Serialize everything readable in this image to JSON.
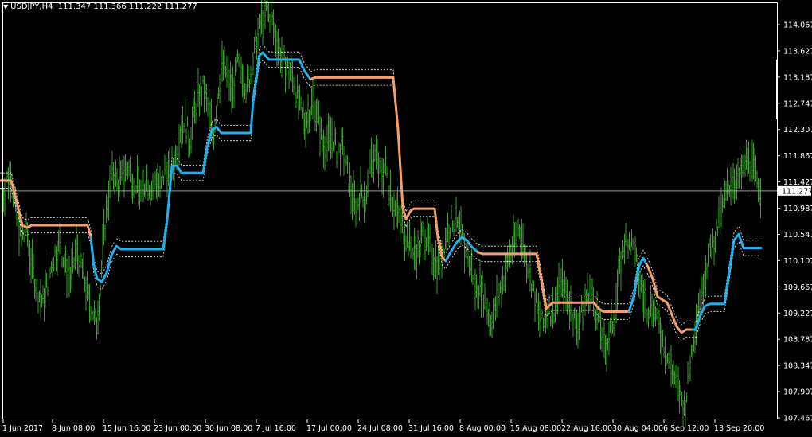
{
  "header": {
    "symbol": "USDJPY,H4",
    "ohlc": "111.347 111.366 111.222 111.277"
  },
  "colors": {
    "background": "#000000",
    "frame": "#ffffff",
    "bars": "#3c9b2e",
    "up_trend": "#1fb1ee",
    "down_trend": "#f5a06a",
    "envelope": "#ffffff",
    "bid_line": "#9a9a9a"
  },
  "chart_data": {
    "type": "line",
    "title": "USDJPY,H4",
    "y_axis_ticks": [
      "114.067",
      "113.627",
      "113.187",
      "112.747",
      "112.307",
      "111.867",
      "111.427",
      "110.987",
      "110.547",
      "110.107",
      "109.667",
      "109.227",
      "108.787",
      "108.347",
      "107.907",
      "107.467"
    ],
    "x_axis_labels": [
      "1 Jun 2017",
      "8 Jun 08:00",
      "15 Jun 16:00",
      "23 Jun 00:00",
      "30 Jun 08:00",
      "7 Jul 16:00",
      "17 Jul 00:00",
      "24 Jul 08:00",
      "31 Jul 16:00",
      "8 Aug 00:00",
      "15 Aug 08:00",
      "22 Aug 16:00",
      "30 Aug 04:00",
      "6 Sep 12:00",
      "13 Sep 20:00"
    ],
    "ylim": [
      107.4,
      114.4
    ],
    "current_price": "111.277",
    "price_path": [
      [
        0,
        110.9
      ],
      [
        7,
        111.4
      ],
      [
        14,
        111.6
      ],
      [
        20,
        110.9
      ],
      [
        27,
        110.5
      ],
      [
        34,
        110.6
      ],
      [
        40,
        110.0
      ],
      [
        47,
        109.6
      ],
      [
        54,
        109.4
      ],
      [
        61,
        109.8
      ],
      [
        68,
        110.2
      ],
      [
        75,
        110.4
      ],
      [
        82,
        110.0
      ],
      [
        89,
        109.8
      ],
      [
        96,
        110.3
      ],
      [
        103,
        110.0
      ],
      [
        110,
        109.5
      ],
      [
        116,
        109.3
      ],
      [
        121,
        109.0
      ],
      [
        126,
        109.7
      ],
      [
        131,
        110.6
      ],
      [
        136,
        111.2
      ],
      [
        142,
        111.6
      ],
      [
        148,
        111.4
      ],
      [
        154,
        111.5
      ],
      [
        160,
        111.7
      ],
      [
        166,
        111.5
      ],
      [
        172,
        111.4
      ],
      [
        178,
        111.2
      ],
      [
        184,
        111.5
      ],
      [
        190,
        111.3
      ],
      [
        196,
        111.5
      ],
      [
        202,
        111.3
      ],
      [
        208,
        111.7
      ],
      [
        214,
        111.5
      ],
      [
        220,
        111.8
      ],
      [
        226,
        112.3
      ],
      [
        232,
        112.5
      ],
      [
        238,
        112.1
      ],
      [
        244,
        112.6
      ],
      [
        250,
        112.9
      ],
      [
        256,
        113.0
      ],
      [
        262,
        112.6
      ],
      [
        268,
        112.2
      ],
      [
        274,
        113.0
      ],
      [
        280,
        113.4
      ],
      [
        286,
        113.2
      ],
      [
        292,
        112.9
      ],
      [
        298,
        113.4
      ],
      [
        304,
        113.3
      ],
      [
        310,
        113.0
      ],
      [
        316,
        113.3
      ],
      [
        322,
        113.8
      ],
      [
        328,
        114.1
      ],
      [
        334,
        114.3
      ],
      [
        340,
        114.2
      ],
      [
        346,
        113.9
      ],
      [
        352,
        113.6
      ],
      [
        358,
        113.4
      ],
      [
        364,
        113.3
      ],
      [
        370,
        113.1
      ],
      [
        376,
        112.7
      ],
      [
        382,
        112.4
      ],
      [
        388,
        112.6
      ],
      [
        394,
        112.8
      ],
      [
        400,
        112.5
      ],
      [
        406,
        112.0
      ],
      [
        412,
        112.1
      ],
      [
        418,
        112.2
      ],
      [
        424,
        111.9
      ],
      [
        430,
        112.0
      ],
      [
        436,
        111.6
      ],
      [
        442,
        111.2
      ],
      [
        448,
        111.0
      ],
      [
        454,
        111.3
      ],
      [
        460,
        111.1
      ],
      [
        466,
        111.7
      ],
      [
        472,
        111.9
      ],
      [
        478,
        111.5
      ],
      [
        484,
        111.7
      ],
      [
        490,
        111.3
      ],
      [
        496,
        111.0
      ],
      [
        502,
        110.8
      ],
      [
        508,
        110.6
      ],
      [
        514,
        110.4
      ],
      [
        520,
        110.2
      ],
      [
        526,
        110.3
      ],
      [
        532,
        110.6
      ],
      [
        538,
        110.4
      ],
      [
        544,
        110.2
      ],
      [
        550,
        110.0
      ],
      [
        556,
        110.3
      ],
      [
        562,
        110.6
      ],
      [
        568,
        110.8
      ],
      [
        574,
        110.7
      ],
      [
        580,
        110.5
      ],
      [
        586,
        110.2
      ],
      [
        592,
        110.0
      ],
      [
        598,
        109.6
      ],
      [
        604,
        109.7
      ],
      [
        610,
        109.4
      ],
      [
        616,
        109.1
      ],
      [
        622,
        109.3
      ],
      [
        628,
        109.6
      ],
      [
        634,
        109.9
      ],
      [
        640,
        110.2
      ],
      [
        646,
        110.4
      ],
      [
        652,
        110.7
      ],
      [
        658,
        110.3
      ],
      [
        664,
        110.0
      ],
      [
        670,
        109.6
      ],
      [
        676,
        109.2
      ],
      [
        682,
        109.0
      ],
      [
        688,
        109.3
      ],
      [
        694,
        109.2
      ],
      [
        700,
        109.5
      ],
      [
        706,
        109.7
      ],
      [
        712,
        109.5
      ],
      [
        718,
        109.3
      ],
      [
        724,
        109.0
      ],
      [
        730,
        109.2
      ],
      [
        736,
        109.5
      ],
      [
        742,
        109.6
      ],
      [
        748,
        109.3
      ],
      [
        754,
        109.0
      ],
      [
        760,
        108.6
      ],
      [
        766,
        108.9
      ],
      [
        772,
        109.2
      ],
      [
        778,
        109.9
      ],
      [
        784,
        110.4
      ],
      [
        790,
        110.5
      ],
      [
        796,
        110.3
      ],
      [
        802,
        109.9
      ],
      [
        808,
        109.5
      ],
      [
        814,
        109.3
      ],
      [
        820,
        109.4
      ],
      [
        826,
        109.1
      ],
      [
        832,
        108.8
      ],
      [
        838,
        108.5
      ],
      [
        844,
        108.3
      ],
      [
        850,
        108.0
      ],
      [
        856,
        107.8
      ],
      [
        860,
        107.6
      ],
      [
        866,
        108.3
      ],
      [
        872,
        108.9
      ],
      [
        878,
        109.4
      ],
      [
        884,
        109.8
      ],
      [
        890,
        110.2
      ],
      [
        896,
        110.4
      ],
      [
        902,
        110.7
      ],
      [
        908,
        111.0
      ],
      [
        914,
        111.3
      ],
      [
        920,
        111.5
      ],
      [
        926,
        111.4
      ],
      [
        932,
        111.6
      ],
      [
        938,
        111.8
      ],
      [
        944,
        111.7
      ],
      [
        950,
        111.5
      ],
      [
        956,
        111.3
      ]
    ],
    "series": [
      {
        "name": "",
        "points": [
          [
            0,
            111.45
          ],
          [
            14,
            111.45
          ],
          [
            20,
            111.15
          ],
          [
            28,
            110.7
          ],
          [
            34,
            110.66
          ],
          [
            40,
            110.7
          ],
          [
            110,
            110.7
          ],
          [
            114,
            110.5
          ],
          [
            118,
            110.0
          ],
          [
            122,
            109.8
          ],
          [
            128,
            109.75
          ],
          [
            134,
            109.9
          ],
          [
            140,
            110.2
          ],
          [
            146,
            110.35
          ],
          [
            152,
            110.3
          ],
          [
            205,
            110.3
          ],
          [
            210,
            110.8
          ],
          [
            216,
            111.7
          ],
          [
            222,
            111.7
          ],
          [
            228,
            111.58
          ],
          [
            255,
            111.58
          ],
          [
            260,
            112.0
          ],
          [
            266,
            112.3
          ],
          [
            272,
            112.35
          ],
          [
            278,
            112.25
          ],
          [
            315,
            112.25
          ],
          [
            318,
            112.8
          ],
          [
            326,
            113.55
          ],
          [
            330,
            113.6
          ],
          [
            338,
            113.48
          ],
          [
            376,
            113.48
          ],
          [
            382,
            113.3
          ],
          [
            390,
            113.15
          ],
          [
            396,
            113.18
          ],
          [
            494,
            113.18
          ],
          [
            500,
            112.3
          ],
          [
            506,
            111.0
          ],
          [
            510,
            110.8
          ],
          [
            516,
            110.95
          ],
          [
            520,
            110.98
          ],
          [
            546,
            110.98
          ],
          [
            550,
            110.5
          ],
          [
            556,
            110.15
          ],
          [
            560,
            110.1
          ],
          [
            566,
            110.25
          ],
          [
            574,
            110.42
          ],
          [
            580,
            110.5
          ],
          [
            586,
            110.45
          ],
          [
            592,
            110.35
          ],
          [
            600,
            110.25
          ],
          [
            606,
            110.22
          ],
          [
            674,
            110.22
          ],
          [
            680,
            109.8
          ],
          [
            686,
            109.3
          ],
          [
            694,
            109.4
          ],
          [
            746,
            109.4
          ],
          [
            752,
            109.3
          ],
          [
            758,
            109.25
          ],
          [
            790,
            109.25
          ],
          [
            796,
            109.5
          ],
          [
            802,
            110.0
          ],
          [
            808,
            110.15
          ],
          [
            814,
            110.0
          ],
          [
            820,
            109.8
          ],
          [
            826,
            109.5
          ],
          [
            832,
            109.45
          ],
          [
            838,
            109.4
          ],
          [
            844,
            109.2
          ],
          [
            850,
            109.0
          ],
          [
            856,
            108.9
          ],
          [
            862,
            108.95
          ],
          [
            874,
            108.95
          ],
          [
            880,
            109.2
          ],
          [
            886,
            109.35
          ],
          [
            892,
            109.38
          ],
          [
            910,
            109.38
          ],
          [
            916,
            109.9
          ],
          [
            922,
            110.45
          ],
          [
            928,
            110.55
          ],
          [
            934,
            110.32
          ],
          [
            956,
            110.32
          ]
        ],
        "color_segments": [
          {
            "from": 0,
            "to": 114,
            "trend": "down"
          },
          {
            "from": 114,
            "to": 390,
            "trend": "up"
          },
          {
            "from": 390,
            "to": 560,
            "trend": "down"
          },
          {
            "from": 560,
            "to": 600,
            "trend": "up"
          },
          {
            "from": 600,
            "to": 790,
            "trend": "down"
          },
          {
            "from": 790,
            "to": 812,
            "trend": "up"
          },
          {
            "from": 812,
            "to": 870,
            "trend": "down"
          },
          {
            "from": 870,
            "to": 956,
            "trend": "up"
          }
        ],
        "envelope_width": 0.13
      }
    ]
  }
}
